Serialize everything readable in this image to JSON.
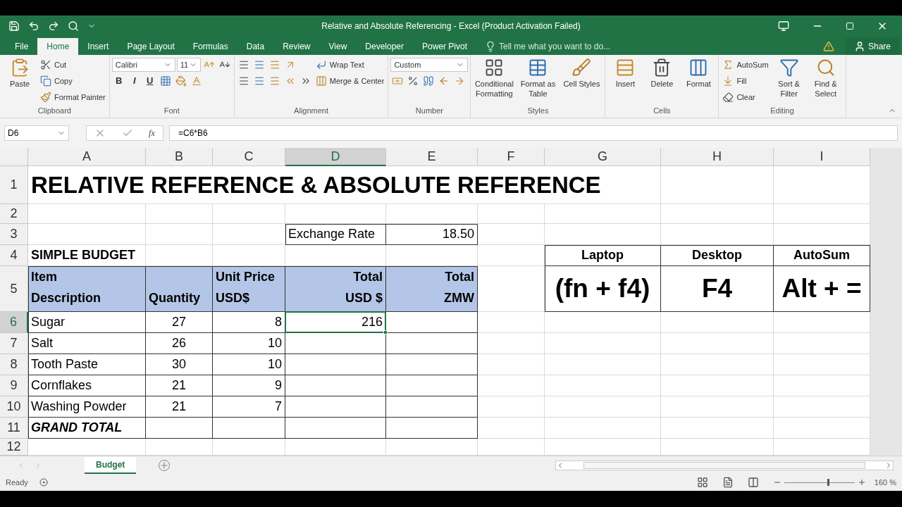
{
  "window": {
    "title": "Relative and Absolute Referencing - Excel (Product Activation Failed)"
  },
  "ribbon_tabs": [
    {
      "label": "File",
      "selected": false
    },
    {
      "label": "Home",
      "selected": true
    },
    {
      "label": "Insert",
      "selected": false
    },
    {
      "label": "Page Layout",
      "selected": false
    },
    {
      "label": "Formulas",
      "selected": false
    },
    {
      "label": "Data",
      "selected": false
    },
    {
      "label": "Review",
      "selected": false
    },
    {
      "label": "View",
      "selected": false
    },
    {
      "label": "Developer",
      "selected": false
    },
    {
      "label": "Power Pivot",
      "selected": false
    }
  ],
  "tell_me": {
    "placeholder": "Tell me what you want to do..."
  },
  "share": "Share",
  "ribbon": [
    {
      "label": "Clipboard",
      "columns": [
        [
          [
            {
              "kind": "large",
              "label": "Paste"
            }
          ]
        ],
        [
          [
            {
              "kind": "small",
              "label": "Cut"
            }
          ],
          [
            {
              "kind": "small",
              "label": "Copy"
            }
          ],
          [
            {
              "kind": "small",
              "label": "Format Painter"
            }
          ]
        ]
      ]
    },
    {
      "label": "Font",
      "columns": [
        [
          [
            {
              "kind": "field",
              "value": "Calibri"
            },
            {
              "kind": "field",
              "value": "11"
            },
            {
              "kind": "icon"
            },
            {
              "kind": "icon"
            }
          ],
          [
            {
              "kind": "glyph",
              "label": "B"
            },
            {
              "kind": "glyph",
              "label": "I"
            },
            {
              "kind": "glyph",
              "label": "U"
            },
            {
              "kind": "icon"
            },
            {
              "kind": "icon"
            },
            {
              "kind": "icon"
            }
          ]
        ]
      ]
    },
    {
      "label": "Alignment",
      "columns": [
        [
          [
            {
              "kind": "icon"
            },
            {
              "kind": "icon"
            },
            {
              "kind": "icon"
            },
            {
              "kind": "icon"
            }
          ],
          [
            {
              "kind": "icon"
            },
            {
              "kind": "icon"
            },
            {
              "kind": "icon"
            },
            {
              "kind": "icon"
            },
            {
              "kind": "icon"
            }
          ]
        ],
        [
          [
            {
              "kind": "small",
              "label": "Wrap Text"
            }
          ],
          [
            {
              "kind": "small",
              "label": "Merge & Center"
            }
          ]
        ]
      ]
    },
    {
      "label": "Number",
      "columns": [
        [
          [
            {
              "kind": "field",
              "value": "Custom"
            }
          ],
          [
            {
              "kind": "icon"
            },
            {
              "kind": "icon"
            },
            {
              "kind": "icon"
            },
            {
              "kind": "icon"
            },
            {
              "kind": "icon"
            }
          ]
        ]
      ]
    },
    {
      "label": "Styles",
      "columns": [
        [
          [
            {
              "kind": "large",
              "label": "Conditional Formatting"
            }
          ]
        ],
        [
          [
            {
              "kind": "large",
              "label": "Format as Table"
            }
          ]
        ],
        [
          [
            {
              "kind": "large",
              "label": "Cell Styles"
            }
          ]
        ]
      ]
    },
    {
      "label": "Cells",
      "columns": [
        [
          [
            {
              "kind": "large",
              "label": "Insert"
            }
          ]
        ],
        [
          [
            {
              "kind": "large",
              "label": "Delete"
            }
          ]
        ],
        [
          [
            {
              "kind": "large",
              "label": "Format"
            }
          ]
        ]
      ]
    },
    {
      "label": "Editing",
      "columns": [
        [
          [
            {
              "kind": "small",
              "label": "AutoSum"
            }
          ],
          [
            {
              "kind": "small",
              "label": "Fill"
            }
          ],
          [
            {
              "kind": "small",
              "label": "Clear"
            }
          ]
        ],
        [
          [
            {
              "kind": "large",
              "label": "Sort & Filter"
            }
          ]
        ],
        [
          [
            {
              "kind": "large",
              "label": "Find & Select"
            }
          ]
        ]
      ]
    }
  ],
  "formula_bar": {
    "name_box": "D6",
    "function_label": "fx",
    "formula": "=C6*B6"
  },
  "columns": [
    {
      "label": "A",
      "selected": false
    },
    {
      "label": "B",
      "selected": false
    },
    {
      "label": "C",
      "selected": false
    },
    {
      "label": "D",
      "selected": true
    },
    {
      "label": "E",
      "selected": false
    },
    {
      "label": "F",
      "selected": false
    },
    {
      "label": "G",
      "selected": false
    },
    {
      "label": "H",
      "selected": false
    },
    {
      "label": "I",
      "selected": false
    }
  ],
  "rows": [
    {
      "number": "1",
      "selected": false,
      "cells": [
        "RELATIVE REFERENCE & ABSOLUTE REFERENCE"
      ]
    },
    {
      "number": "2",
      "selected": false,
      "cells": []
    },
    {
      "number": "3",
      "selected": false,
      "cells": [
        null,
        null,
        null,
        "Exchange Rate",
        "18.50"
      ]
    },
    {
      "number": "4",
      "selected": false,
      "cells": [
        "SIMPLE BUDGET",
        null,
        null,
        null,
        null,
        null,
        "Laptop",
        "Desktop",
        "AutoSum"
      ]
    },
    {
      "number": "5",
      "selected": false,
      "cells": [
        "Item\nDescription",
        "Quantity",
        "Unit Price\nUSD$",
        "Total\nUSD $",
        "Total\nZMW",
        null,
        "(fn + f4)",
        "F4",
        "Alt + ="
      ]
    },
    {
      "number": "6",
      "selected": true,
      "cells": [
        "Sugar",
        "27",
        "8",
        "216"
      ]
    },
    {
      "number": "7",
      "selected": false,
      "cells": [
        "Salt",
        "26",
        "10"
      ]
    },
    {
      "number": "8",
      "selected": false,
      "cells": [
        "Tooth Paste",
        "30",
        "10"
      ]
    },
    {
      "number": "9",
      "selected": false,
      "cells": [
        "Cornflakes",
        "21",
        "9"
      ]
    },
    {
      "number": "10",
      "selected": false,
      "cells": [
        "Washing Powder",
        "21",
        "7"
      ]
    },
    {
      "number": "11",
      "selected": false,
      "cells": [
        "GRAND TOTAL"
      ]
    },
    {
      "number": "12",
      "selected": false,
      "cells": []
    }
  ],
  "sheet_tabs": [
    {
      "label": "Budget",
      "selected": true
    }
  ],
  "status_bar": {
    "status": "Ready",
    "zoom": "160 %",
    "zoom_slider": {
      "level": 0.62
    }
  }
}
